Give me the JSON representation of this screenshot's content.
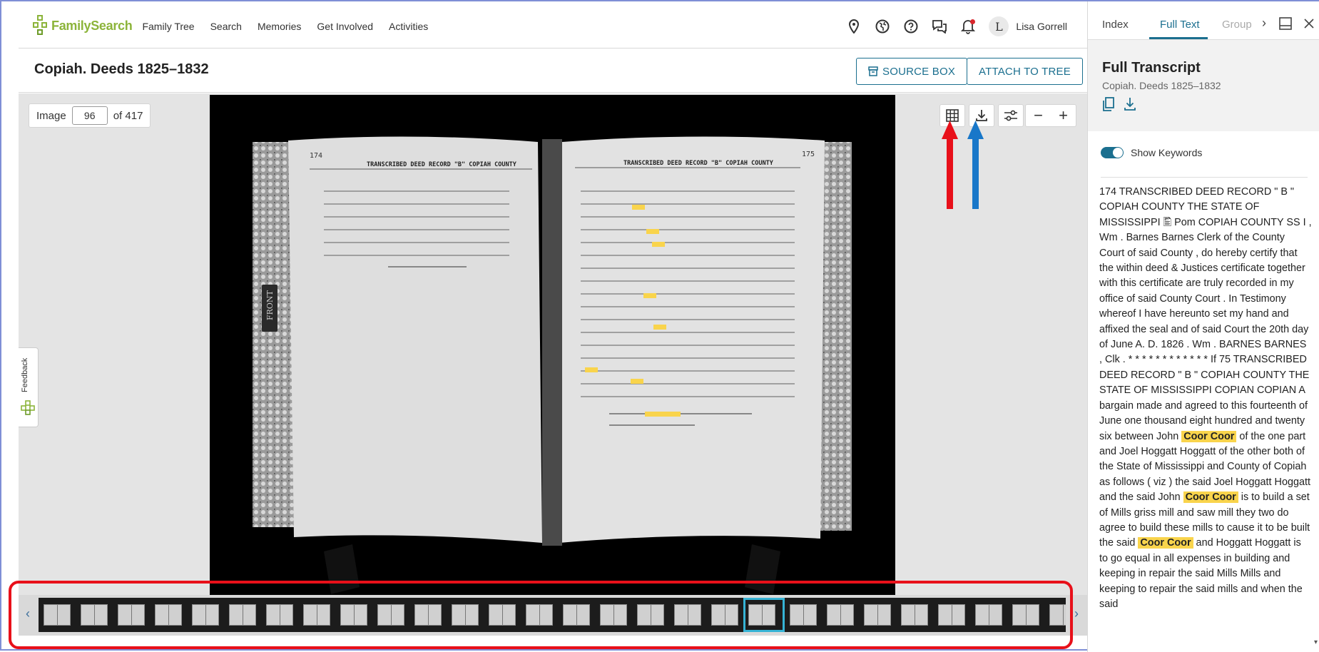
{
  "header": {
    "logo_text": "FamilySearch",
    "nav": [
      "Family Tree",
      "Search",
      "Memories",
      "Get Involved",
      "Activities"
    ],
    "icons": [
      "location-pin-icon",
      "globe-icon",
      "help-icon",
      "chat-icon",
      "bell-icon"
    ],
    "avatar_initial": "L",
    "user_name": "Lisa Gorrell"
  },
  "titlebar": {
    "title": "Copiah. Deeds 1825–1832",
    "source_box_label": "SOURCE BOX",
    "attach_label": "ATTACH TO TREE"
  },
  "viewer": {
    "image_label": "Image",
    "image_number": "96",
    "image_total": "of 417",
    "feedback_label": "Feedback",
    "filmstrip_thumb_count": 28,
    "filmstrip_selected_index": 19
  },
  "panel": {
    "tabs": [
      "Index",
      "Full Text",
      "Group"
    ],
    "active_tab": "Full Text",
    "heading": "Full Transcript",
    "subtitle": "Copiah. Deeds 1825–1832",
    "show_keywords_label": "Show Keywords",
    "show_keywords_on": true,
    "keyword": "Coor",
    "transcript": [
      {
        "t": "174 TRANSCRIBED DEED RECORD \" B \" COPIAH COUNTY THE STATE OF MISSISSIPPI 🖺 Pom COPIAH COUNTY SS I , Wm . Barnes Barnes Clerk of the County Court of said County , do hereby certify that the within deed & Justices certificate together with this certificate are truly recorded in my office of said County Court . In Testimony whereof I have hereunto set my hand and affixed the seal and of said Court the 20th day of June A. D. 1826 . Wm . BARNES BARNES , Clk . * * * * * * * * * * * * If 75 TRANSCRIBED DEED RECORD \" B \" COPIAH COUNTY THE STATE OF MISSISSIPPI COPIAN COPIAN A bargain made and agreed to this fourteenth of June one thousand eight hundred and twenty six between John "
      },
      {
        "k": "Coor  Coor"
      },
      {
        "t": " of the one part and Joel Hoggatt Hoggatt of the other both of the State of Mississippi and County of Copiah as follows ( viz ) the said Joel Hoggatt Hoggatt and the said John "
      },
      {
        "k": "Coor  Coor"
      },
      {
        "t": " is to build a set of Mills griss mill and saw mill they two do agree to build these mills to cause it to be built the said "
      },
      {
        "k": "Coor  Coor"
      },
      {
        "t": " and Hoggatt Hoggatt is to go equal in all expenses in building and keeping in repair the said Mills Mills and keeping to repair the said mills and when the said "
      }
    ]
  },
  "colors": {
    "accent": "#1b6f8f",
    "keyword_highlight": "#f9d44c",
    "annotation_red": "#e8101a",
    "annotation_blue": "#1877c9",
    "brand_green": "#8cb43a"
  }
}
